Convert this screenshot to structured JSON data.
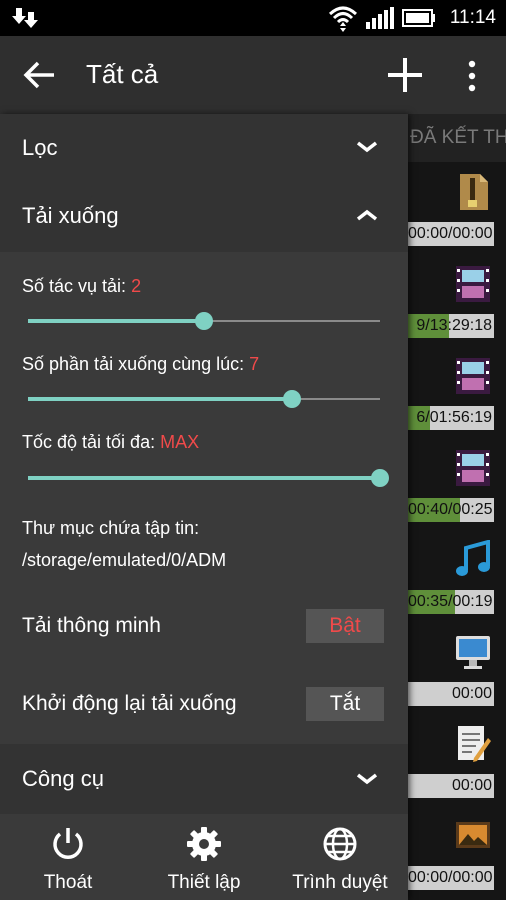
{
  "status_bar": {
    "time": "11:14"
  },
  "toolbar": {
    "title": "Tất cả"
  },
  "background_list": {
    "tab_label": "ĐÃ KẾT THÚ",
    "rows": [
      {
        "progress_text": "00:00/00:00",
        "progress": 0
      },
      {
        "progress_text": "9/13:29:18",
        "progress": 0.48
      },
      {
        "progress_text": "6/01:56:19",
        "progress": 0.25
      },
      {
        "progress_text": "00:40/00:25",
        "progress": 0.6
      },
      {
        "progress_text": "00:35/00:19",
        "progress": 0.55
      },
      {
        "progress_text": "00:00",
        "progress": 0
      },
      {
        "progress_text": "00:00",
        "progress": 0
      },
      {
        "progress_text": "00:00/00:00",
        "progress": 0
      }
    ]
  },
  "drawer": {
    "filter_label": "Lọc",
    "download_label": "Tải xuống",
    "tasks": {
      "label": "Số tác vụ tải: ",
      "value": "2",
      "fraction": 0.5
    },
    "parts": {
      "label": "Số phần tải xuống cùng lúc: ",
      "value": "7",
      "fraction": 0.75
    },
    "speed": {
      "label": "Tốc độ tải tối đa: ",
      "value": "MAX",
      "fraction": 1.0
    },
    "folder_label": "Thư mục chứa tập tin:",
    "folder_path": "/storage/emulated/0/ADM",
    "smart_label": "Tải thông minh",
    "smart_value": "Bật",
    "restart_label": "Khởi động lại tải xuống",
    "restart_value": "Tắt",
    "tools_label": "Công cụ"
  },
  "bottom_bar": {
    "exit": "Thoát",
    "settings": "Thiết lập",
    "browser": "Trình duyệt"
  },
  "colors": {
    "accent": "#7fd1c3",
    "value_red": "#f04a4a",
    "progress_green": "#5f8f3a"
  }
}
